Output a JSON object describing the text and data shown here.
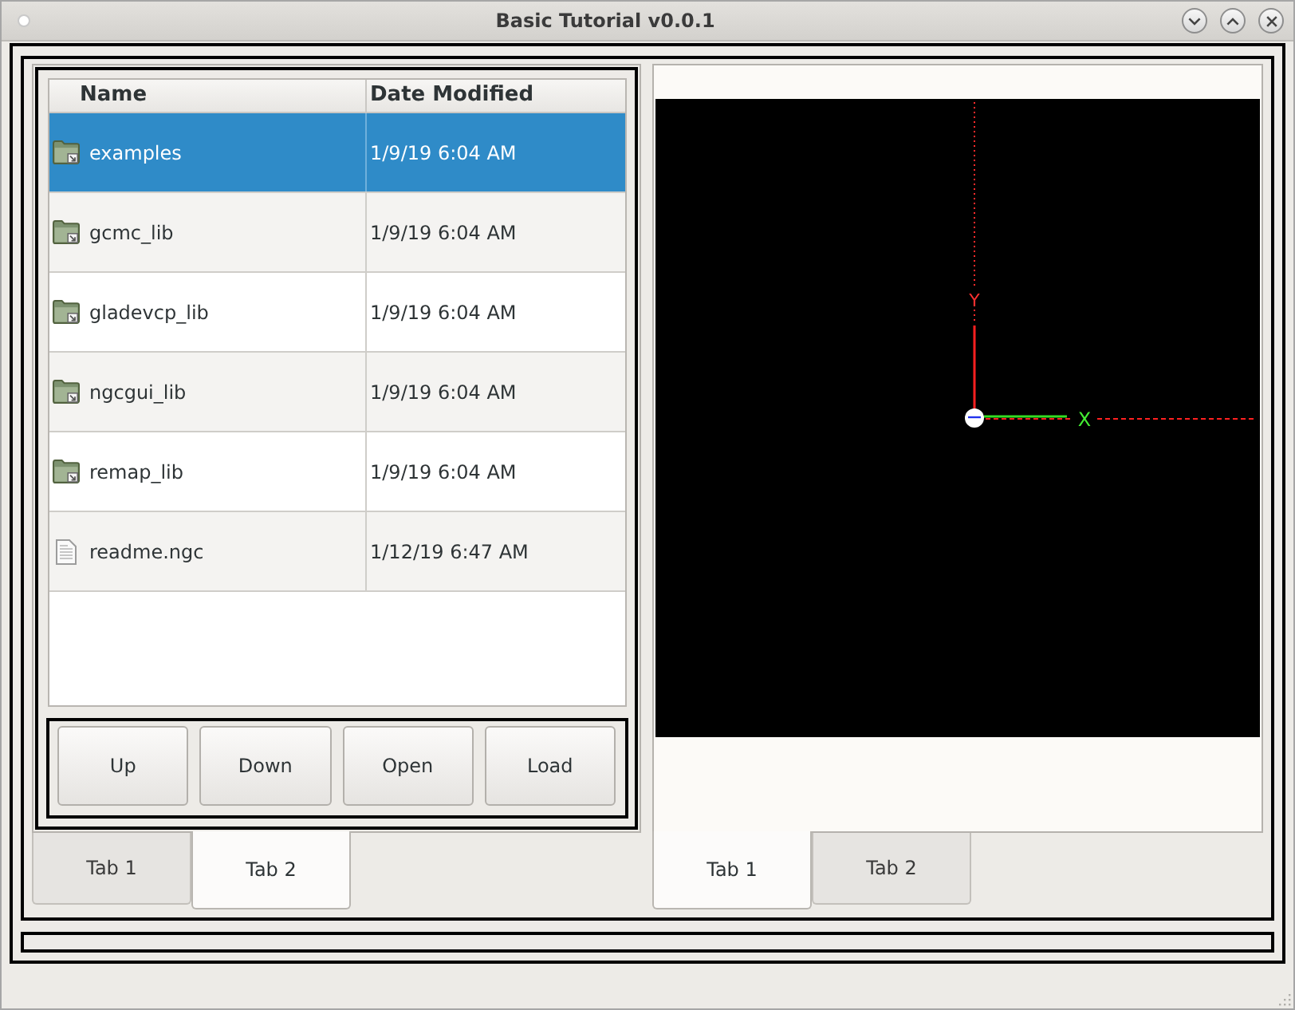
{
  "window": {
    "title": "Basic Tutorial v0.0.1"
  },
  "file_browser": {
    "columns": [
      "Name",
      "Date Modified"
    ],
    "rows": [
      {
        "kind": "folder",
        "name": "examples",
        "modified": "1/9/19 6:04 AM",
        "selected": true
      },
      {
        "kind": "folder",
        "name": "gcmc_lib",
        "modified": "1/9/19 6:04 AM",
        "selected": false
      },
      {
        "kind": "folder",
        "name": "gladevcp_lib",
        "modified": "1/9/19 6:04 AM",
        "selected": false
      },
      {
        "kind": "folder",
        "name": "ngcgui_lib",
        "modified": "1/9/19 6:04 AM",
        "selected": false
      },
      {
        "kind": "folder",
        "name": "remap_lib",
        "modified": "1/9/19 6:04 AM",
        "selected": false
      },
      {
        "kind": "file",
        "name": "readme.ngc",
        "modified": "1/12/19 6:47 AM",
        "selected": false
      }
    ]
  },
  "buttons": [
    "Up",
    "Down",
    "Open",
    "Load"
  ],
  "left_tabs": [
    {
      "label": "Tab 1",
      "selected": false
    },
    {
      "label": "Tab 2",
      "selected": true
    }
  ],
  "preview": {
    "y_axis_label": "Y",
    "x_axis_label": "X"
  },
  "right_tabs": [
    {
      "label": "Tab 1",
      "selected": true
    },
    {
      "label": "Tab 2",
      "selected": false
    }
  ]
}
